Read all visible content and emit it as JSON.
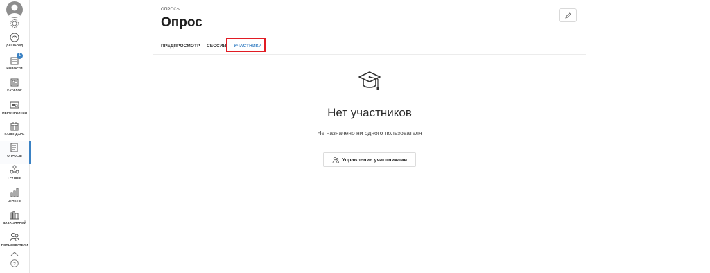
{
  "sidebar": {
    "items": [
      {
        "label": "ДАШБОРД",
        "icon": "dashboard-icon"
      },
      {
        "label": "НОВОСТИ",
        "icon": "news-icon",
        "badge": "1"
      },
      {
        "label": "КАТАЛОГ",
        "icon": "catalog-icon"
      },
      {
        "label": "МЕРОПРИЯТИЯ",
        "icon": "events-icon"
      },
      {
        "label": "КАЛЕНДАРЬ",
        "icon": "calendar-icon"
      },
      {
        "label": "ОПРОСЫ",
        "icon": "surveys-icon",
        "active": true
      },
      {
        "label": "ГРУППЫ",
        "icon": "groups-icon"
      },
      {
        "label": "ОТЧЕТЫ",
        "icon": "reports-icon"
      },
      {
        "label": "БАЗА ЗНАНИЙ",
        "icon": "knowledge-base-icon"
      },
      {
        "label": "ПОЛЬЗОВАТЕЛИ",
        "icon": "users-icon"
      }
    ]
  },
  "header": {
    "breadcrumb": "ОПРОСЫ",
    "title": "Опрос"
  },
  "tabs": [
    {
      "label": "ПРЕДПРОСМОТР"
    },
    {
      "label": "СЕССИИ"
    },
    {
      "label": "УЧАСТНИКИ",
      "active": true
    }
  ],
  "empty_state": {
    "icon": "graduation-cap-icon",
    "title": "Нет участников",
    "subtitle": "Не назначено ни одного пользователя",
    "button_label": "Управление участниками"
  },
  "colors": {
    "accent": "#3b82c4",
    "highlight": "#e11c24"
  }
}
